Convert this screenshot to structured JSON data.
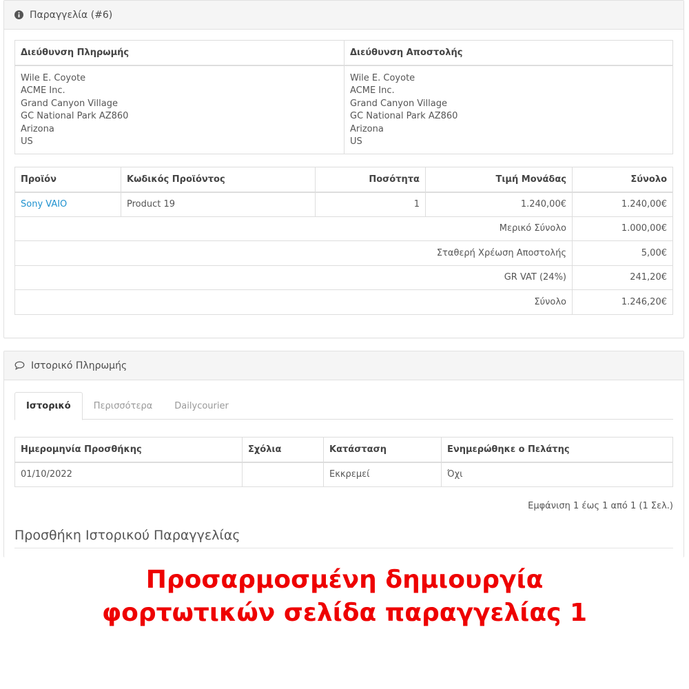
{
  "order_panel": {
    "title": "Παραγγελία (#6)",
    "icon": "info-circle-icon"
  },
  "addresses": {
    "payment_header": "Διεύθυνση Πληρωμής",
    "shipping_header": "Διεύθυνση Αποστολής",
    "payment_lines": [
      "Wile E. Coyote",
      "ACME Inc.",
      "Grand Canyon Village",
      "GC National Park AZ860",
      "Arizona",
      "US"
    ],
    "shipping_lines": [
      "Wile E. Coyote",
      "ACME Inc.",
      "Grand Canyon Village",
      "GC National Park AZ860",
      "Arizona",
      "US"
    ]
  },
  "products": {
    "headers": [
      "Προϊόν",
      "Κωδικός Προϊόντος",
      "Ποσότητα",
      "Τιμή Μονάδας",
      "Σύνολο"
    ],
    "rows": [
      {
        "name": "Sony VAIO",
        "model": "Product 19",
        "quantity": "1",
        "price": "1.240,00€",
        "total": "1.240,00€"
      }
    ],
    "totals": [
      {
        "label": "Μερικό Σύνολο",
        "value": "1.000,00€"
      },
      {
        "label": "Σταθερή Χρέωση Αποστολής",
        "value": "5,00€"
      },
      {
        "label": "GR VAT (24%)",
        "value": "241,20€"
      },
      {
        "label": "Σύνολο",
        "value": "1.246,20€"
      }
    ]
  },
  "history_panel": {
    "title": "Ιστορικό Πληρωμής",
    "icon": "comment-icon",
    "tabs": [
      "Ιστορικό",
      "Περισσότερα",
      "Dailycourier"
    ],
    "headers": [
      "Ημερομηνία Προσθήκης",
      "Σχόλια",
      "Κατάσταση",
      "Ενημερώθηκε ο Πελάτης"
    ],
    "rows": [
      {
        "date": "01/10/2022",
        "comment": "",
        "status": "Εκκρεμεί",
        "notified": "Όχι"
      }
    ],
    "pager": "Εμφάνιση 1 έως 1 από 1 (1 Σελ.)",
    "add_history_title": "Προσθήκη Ιστορικού Παραγγελίας"
  },
  "banner": {
    "line1": "Προσαρμοσμένη δημιουργία",
    "line2": "φορτωτικών σελίδα παραγγελίας 1"
  },
  "colors": {
    "link": "#1e91cf",
    "banner": "#ee0000",
    "panel_header_bg": "#f5f5f5"
  }
}
